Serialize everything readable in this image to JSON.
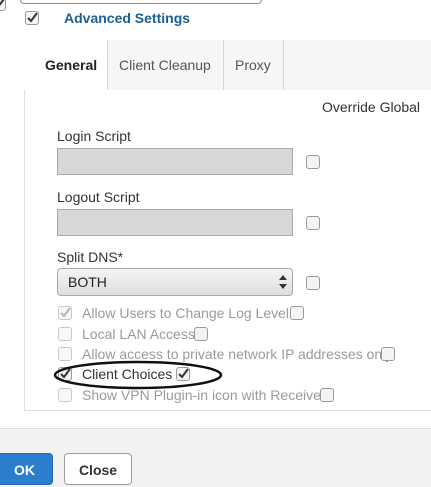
{
  "header": {
    "advanced_label": "Advanced Settings"
  },
  "tabs": [
    {
      "label": "General"
    },
    {
      "label": "Client Cleanup"
    },
    {
      "label": "Proxy"
    }
  ],
  "general": {
    "override_global": "Override Global",
    "login_script_label": "Login Script",
    "login_script_value": "",
    "logout_script_label": "Logout Script",
    "logout_script_value": "",
    "split_dns_label": "Split DNS*",
    "split_dns_value": "BOTH",
    "options": [
      {
        "label": "Allow Users to Change Log Levels",
        "checked": true
      },
      {
        "label": "Local LAN Access",
        "checked": false
      },
      {
        "label": "Allow access to private network IP addresses only",
        "checked": false
      },
      {
        "label": "Client Choices",
        "checked": true,
        "override_checked": true,
        "highlighted": true
      },
      {
        "label": "Show VPN Plugin-in icon with Receiver",
        "checked": false
      }
    ]
  },
  "footer": {
    "ok_label": "OK",
    "close_label": "Close"
  },
  "colors": {
    "accent": "#2b7dcd",
    "tab_bar": "#f6f6f6",
    "field_fill": "#d7d7d7",
    "footer_bg": "#f2f2f2"
  }
}
